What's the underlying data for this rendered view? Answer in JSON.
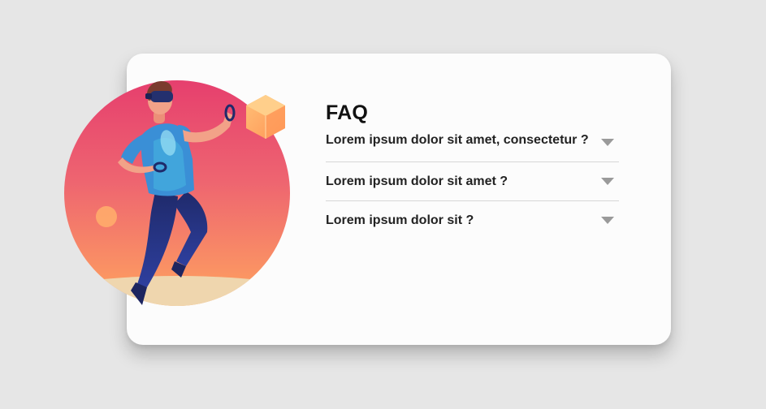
{
  "faq": {
    "title": "FAQ",
    "items": [
      {
        "question": "Lorem ipsum dolor sit amet, consectetur ?"
      },
      {
        "question": "Lorem ipsum dolor sit amet ?"
      },
      {
        "question": "Lorem ipsum dolor sit ?"
      }
    ]
  },
  "illustration": {
    "icon": "person-vr-headset-illustration"
  },
  "colors": {
    "background": "#e6e6e6",
    "card": "#fcfcfc",
    "circle_top": "#e84670",
    "circle_bottom": "#ffa062",
    "arrow": "#9a9a9a",
    "divider": "#d6d6d6"
  }
}
